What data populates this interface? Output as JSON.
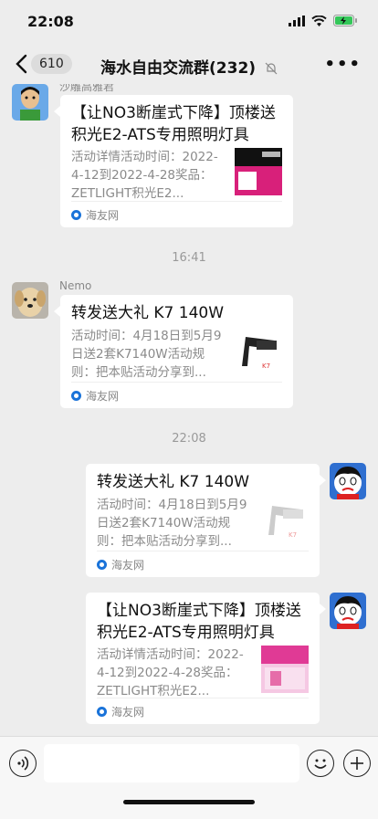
{
  "status": {
    "time": "22:08"
  },
  "nav": {
    "badge": "610",
    "title": "海水自由交流群(232)"
  },
  "messages": [
    {
      "sender": "沙雕高雅君",
      "title": "【让NO3断崖式下降】顶楼送积光E2-ATS专用照明灯具",
      "desc": "活动详情活动时间：2022-4-12到2022-4-28奖品：ZETLIGHT积光E2...",
      "source": "海友网"
    },
    {
      "sender": "Nemo",
      "title": "转发送大礼 K7 140W",
      "desc": "活动时间：4月18日到5月9日送2套K7140W活动规则：把本贴活动分享到...",
      "source": "海友网"
    },
    {
      "title": "转发送大礼 K7 140W",
      "desc": "活动时间：4月18日到5月9日送2套K7140W活动规则：把本贴活动分享到...",
      "source": "海友网"
    },
    {
      "title": "【让NO3断崖式下降】顶楼送积光E2-ATS专用照明灯具",
      "desc": "活动详情活动时间：2022-4-12到2022-4-28奖品：ZETLIGHT积光E2...",
      "source": "海友网"
    }
  ],
  "timestamps": [
    "16:41",
    "22:08"
  ],
  "colors": {
    "background": "#ededed",
    "bubble": "#ffffff",
    "link_icon": "#1a73d9"
  }
}
